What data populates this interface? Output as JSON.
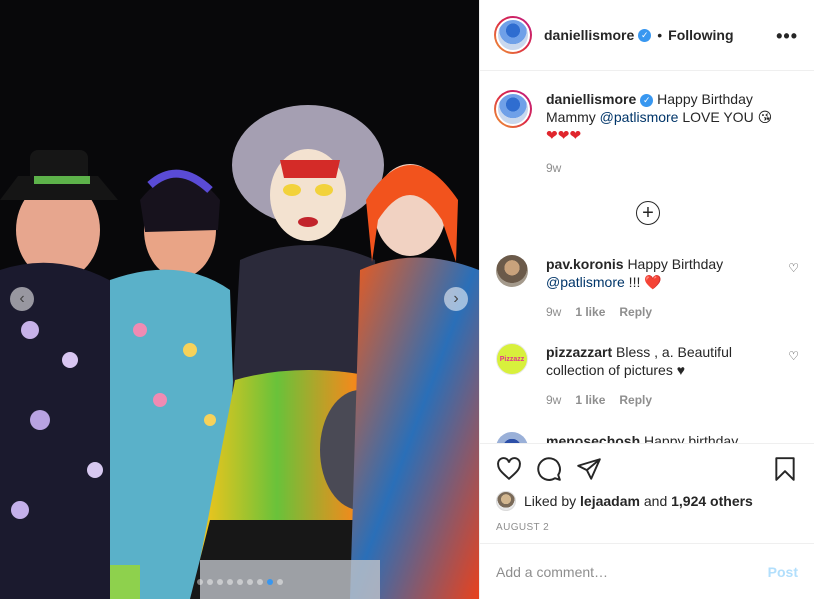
{
  "header": {
    "username": "daniellismore",
    "separator": "•",
    "follow_status": "Following",
    "more_icon": "more-options-icon"
  },
  "caption": {
    "username": "daniellismore",
    "text_before": "Happy Birthday Mammy ",
    "mention": "@patlismore",
    "text_after": " LOVE YOU 😘",
    "hearts": "❤❤❤",
    "time": "9w"
  },
  "load_more_icon": "plus-circle-icon",
  "comments": [
    {
      "username": "pav.koronis",
      "text_before": "Happy Birthday ",
      "mention": "@patlismore",
      "text_after": " !!! ❤️",
      "time": "9w",
      "likes": "1 like",
      "reply": "Reply"
    },
    {
      "username": "pizzazzart",
      "text_before": "Bless , a. Beautiful collection of pictures ♥",
      "mention": "",
      "text_after": "",
      "time": "9w",
      "likes": "1 like",
      "reply": "Reply"
    },
    {
      "username": "menosechosh",
      "text_before": "Happy birthday",
      "mention": "",
      "text_after": "",
      "time": "",
      "likes": "",
      "reply": ""
    }
  ],
  "actions": {
    "like_icon": "heart-icon",
    "comment_icon": "comment-icon",
    "share_icon": "share-icon",
    "save_icon": "bookmark-icon"
  },
  "likes": {
    "prefix": "Liked by ",
    "user": "lejaadam",
    "middle": " and ",
    "others": "1,924 others"
  },
  "date": "AUGUST 2",
  "comment_input": {
    "placeholder": "Add a comment…",
    "value": ""
  },
  "post_button": "Post",
  "carousel": {
    "prev": "‹",
    "next": "›",
    "slide_count": 9,
    "active_index": 7
  },
  "colors": {
    "accent_blue": "#3897f0",
    "mention": "#003569",
    "post_disabled": "#b2dffc"
  }
}
